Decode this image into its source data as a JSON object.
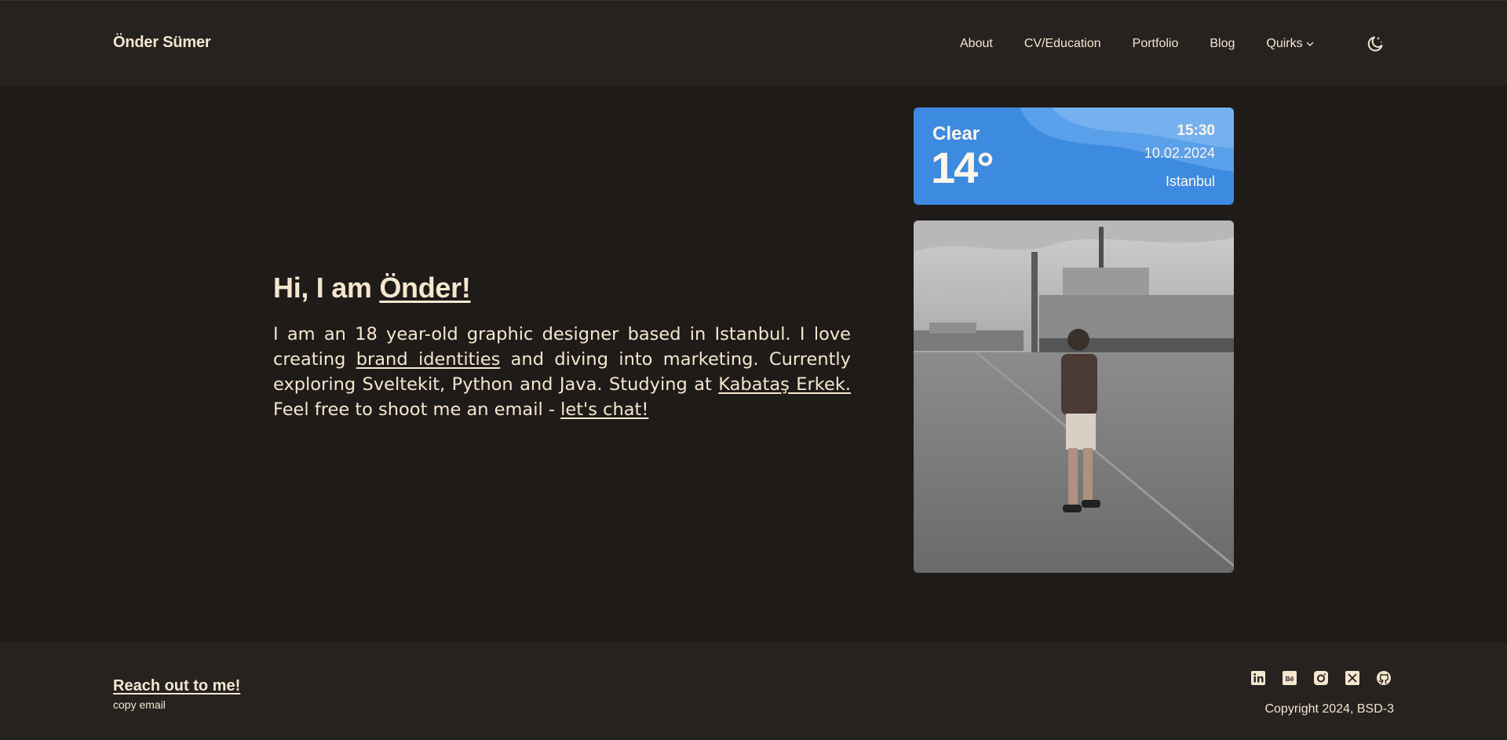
{
  "header": {
    "brand": "Önder Sümer",
    "nav": {
      "about": "About",
      "cv": "CV/Education",
      "portfolio": "Portfolio",
      "blog": "Blog",
      "quirks": "Quirks"
    },
    "theme_icon": "moon-stars-icon"
  },
  "intro": {
    "greeting": "Hi, I am ",
    "name": "Önder!",
    "p1": "I am an 18 year-old graphic designer based in Istanbul. I love creating ",
    "link_brand": "brand identities",
    "p2": " and diving into marketing. Currently exploring Sveltekit, Python and Java. Studying at ",
    "link_school": "Kabataş Erkek.",
    "p3": " Feel free to shoot me an email - ",
    "link_chat": "let's chat!"
  },
  "weather": {
    "condition": "Clear",
    "temperature": "14°",
    "time": "15:30",
    "date": "10.02.2024",
    "city": "Istanbul",
    "color": "#3d8be0"
  },
  "footer": {
    "reach_out": "Reach out to me!",
    "copy_email": "copy email",
    "copyright": "Copyright 2024, BSD-3",
    "socials": [
      "linkedin-icon",
      "behance-icon",
      "instagram-icon",
      "x-icon",
      "github-icon"
    ]
  },
  "colors": {
    "background": "#1f1b19",
    "surface": "#262220",
    "text": "#f5e6cf"
  }
}
